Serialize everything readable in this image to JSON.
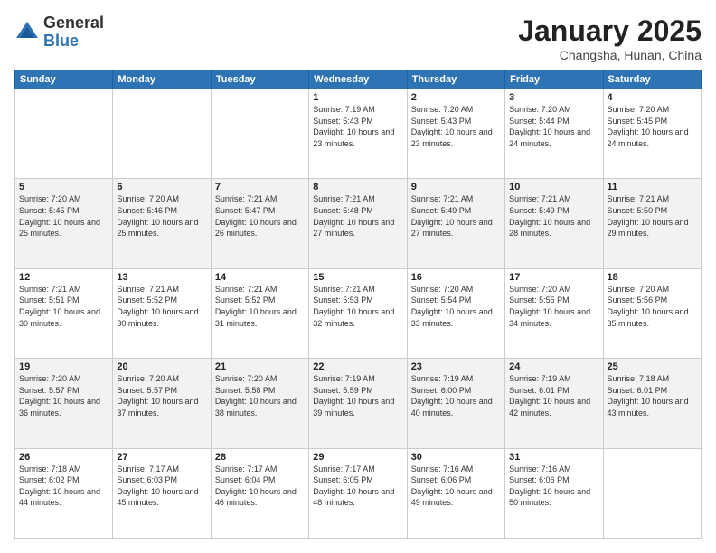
{
  "logo": {
    "general": "General",
    "blue": "Blue"
  },
  "header": {
    "month": "January 2025",
    "location": "Changsha, Hunan, China"
  },
  "weekdays": [
    "Sunday",
    "Monday",
    "Tuesday",
    "Wednesday",
    "Thursday",
    "Friday",
    "Saturday"
  ],
  "weeks": [
    [
      {
        "day": "",
        "sunrise": "",
        "sunset": "",
        "daylight": ""
      },
      {
        "day": "",
        "sunrise": "",
        "sunset": "",
        "daylight": ""
      },
      {
        "day": "",
        "sunrise": "",
        "sunset": "",
        "daylight": ""
      },
      {
        "day": "1",
        "sunrise": "Sunrise: 7:19 AM",
        "sunset": "Sunset: 5:43 PM",
        "daylight": "Daylight: 10 hours and 23 minutes."
      },
      {
        "day": "2",
        "sunrise": "Sunrise: 7:20 AM",
        "sunset": "Sunset: 5:43 PM",
        "daylight": "Daylight: 10 hours and 23 minutes."
      },
      {
        "day": "3",
        "sunrise": "Sunrise: 7:20 AM",
        "sunset": "Sunset: 5:44 PM",
        "daylight": "Daylight: 10 hours and 24 minutes."
      },
      {
        "day": "4",
        "sunrise": "Sunrise: 7:20 AM",
        "sunset": "Sunset: 5:45 PM",
        "daylight": "Daylight: 10 hours and 24 minutes."
      }
    ],
    [
      {
        "day": "5",
        "sunrise": "Sunrise: 7:20 AM",
        "sunset": "Sunset: 5:45 PM",
        "daylight": "Daylight: 10 hours and 25 minutes."
      },
      {
        "day": "6",
        "sunrise": "Sunrise: 7:20 AM",
        "sunset": "Sunset: 5:46 PM",
        "daylight": "Daylight: 10 hours and 25 minutes."
      },
      {
        "day": "7",
        "sunrise": "Sunrise: 7:21 AM",
        "sunset": "Sunset: 5:47 PM",
        "daylight": "Daylight: 10 hours and 26 minutes."
      },
      {
        "day": "8",
        "sunrise": "Sunrise: 7:21 AM",
        "sunset": "Sunset: 5:48 PM",
        "daylight": "Daylight: 10 hours and 27 minutes."
      },
      {
        "day": "9",
        "sunrise": "Sunrise: 7:21 AM",
        "sunset": "Sunset: 5:49 PM",
        "daylight": "Daylight: 10 hours and 27 minutes."
      },
      {
        "day": "10",
        "sunrise": "Sunrise: 7:21 AM",
        "sunset": "Sunset: 5:49 PM",
        "daylight": "Daylight: 10 hours and 28 minutes."
      },
      {
        "day": "11",
        "sunrise": "Sunrise: 7:21 AM",
        "sunset": "Sunset: 5:50 PM",
        "daylight": "Daylight: 10 hours and 29 minutes."
      }
    ],
    [
      {
        "day": "12",
        "sunrise": "Sunrise: 7:21 AM",
        "sunset": "Sunset: 5:51 PM",
        "daylight": "Daylight: 10 hours and 30 minutes."
      },
      {
        "day": "13",
        "sunrise": "Sunrise: 7:21 AM",
        "sunset": "Sunset: 5:52 PM",
        "daylight": "Daylight: 10 hours and 30 minutes."
      },
      {
        "day": "14",
        "sunrise": "Sunrise: 7:21 AM",
        "sunset": "Sunset: 5:52 PM",
        "daylight": "Daylight: 10 hours and 31 minutes."
      },
      {
        "day": "15",
        "sunrise": "Sunrise: 7:21 AM",
        "sunset": "Sunset: 5:53 PM",
        "daylight": "Daylight: 10 hours and 32 minutes."
      },
      {
        "day": "16",
        "sunrise": "Sunrise: 7:20 AM",
        "sunset": "Sunset: 5:54 PM",
        "daylight": "Daylight: 10 hours and 33 minutes."
      },
      {
        "day": "17",
        "sunrise": "Sunrise: 7:20 AM",
        "sunset": "Sunset: 5:55 PM",
        "daylight": "Daylight: 10 hours and 34 minutes."
      },
      {
        "day": "18",
        "sunrise": "Sunrise: 7:20 AM",
        "sunset": "Sunset: 5:56 PM",
        "daylight": "Daylight: 10 hours and 35 minutes."
      }
    ],
    [
      {
        "day": "19",
        "sunrise": "Sunrise: 7:20 AM",
        "sunset": "Sunset: 5:57 PM",
        "daylight": "Daylight: 10 hours and 36 minutes."
      },
      {
        "day": "20",
        "sunrise": "Sunrise: 7:20 AM",
        "sunset": "Sunset: 5:57 PM",
        "daylight": "Daylight: 10 hours and 37 minutes."
      },
      {
        "day": "21",
        "sunrise": "Sunrise: 7:20 AM",
        "sunset": "Sunset: 5:58 PM",
        "daylight": "Daylight: 10 hours and 38 minutes."
      },
      {
        "day": "22",
        "sunrise": "Sunrise: 7:19 AM",
        "sunset": "Sunset: 5:59 PM",
        "daylight": "Daylight: 10 hours and 39 minutes."
      },
      {
        "day": "23",
        "sunrise": "Sunrise: 7:19 AM",
        "sunset": "Sunset: 6:00 PM",
        "daylight": "Daylight: 10 hours and 40 minutes."
      },
      {
        "day": "24",
        "sunrise": "Sunrise: 7:19 AM",
        "sunset": "Sunset: 6:01 PM",
        "daylight": "Daylight: 10 hours and 42 minutes."
      },
      {
        "day": "25",
        "sunrise": "Sunrise: 7:18 AM",
        "sunset": "Sunset: 6:01 PM",
        "daylight": "Daylight: 10 hours and 43 minutes."
      }
    ],
    [
      {
        "day": "26",
        "sunrise": "Sunrise: 7:18 AM",
        "sunset": "Sunset: 6:02 PM",
        "daylight": "Daylight: 10 hours and 44 minutes."
      },
      {
        "day": "27",
        "sunrise": "Sunrise: 7:17 AM",
        "sunset": "Sunset: 6:03 PM",
        "daylight": "Daylight: 10 hours and 45 minutes."
      },
      {
        "day": "28",
        "sunrise": "Sunrise: 7:17 AM",
        "sunset": "Sunset: 6:04 PM",
        "daylight": "Daylight: 10 hours and 46 minutes."
      },
      {
        "day": "29",
        "sunrise": "Sunrise: 7:17 AM",
        "sunset": "Sunset: 6:05 PM",
        "daylight": "Daylight: 10 hours and 48 minutes."
      },
      {
        "day": "30",
        "sunrise": "Sunrise: 7:16 AM",
        "sunset": "Sunset: 6:06 PM",
        "daylight": "Daylight: 10 hours and 49 minutes."
      },
      {
        "day": "31",
        "sunrise": "Sunrise: 7:16 AM",
        "sunset": "Sunset: 6:06 PM",
        "daylight": "Daylight: 10 hours and 50 minutes."
      },
      {
        "day": "",
        "sunrise": "",
        "sunset": "",
        "daylight": ""
      }
    ]
  ]
}
